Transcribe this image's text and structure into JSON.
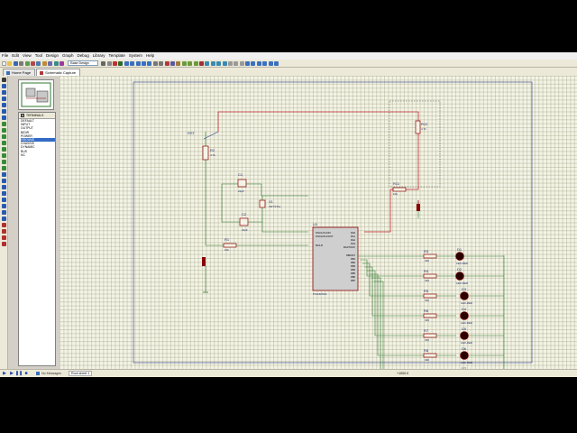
{
  "menu": [
    "File",
    "Edit",
    "View",
    "Tool",
    "Design",
    "Graph",
    "Debug",
    "Library",
    "Template",
    "System",
    "Help"
  ],
  "toolbar": {
    "design_dropdown": "Base Design"
  },
  "tabs": [
    {
      "label": "Home Page",
      "active": false
    },
    {
      "label": "Schematic Capture",
      "active": true
    }
  ],
  "device_panel": {
    "mode_letter": "P",
    "title": "TERMINALS",
    "items": [
      "DEFAULT",
      "INPUT",
      "OUTPUT",
      "BIDIR",
      "POWER",
      "GROUND",
      "CHASSIS",
      "DYNAMIC",
      "BUS",
      "NC"
    ],
    "selected": "GROUND"
  },
  "schematic": {
    "labels": {
      "rst": "RST",
      "c1": "C1",
      "c1_val": "22pF",
      "c2": "C2",
      "c2_val": "22pF",
      "x1": "X1",
      "x1_val": "CRYSTAL",
      "r2": "R2",
      "r2_val": "4.7k",
      "r1": "R1",
      "r1_val": "10k",
      "r11": "R11",
      "r11_val": "10k",
      "r12": "R12",
      "r12_val": "4.7k",
      "u1": "U1",
      "u1_part": "PIC16F84A",
      "u1_left_pins": [
        "OSC1/CLKIN",
        "OSC2/CLKOUT",
        "MCLR"
      ],
      "u1_right_pins": [
        "RA0",
        "RA1",
        "RA2",
        "RA3",
        "RA4/T0CKI",
        "RB0/INT",
        "RB1",
        "RB2",
        "RB3",
        "RB4",
        "RB5",
        "RB6",
        "RB7"
      ],
      "resistors": [
        {
          "ref": "R3",
          "val": "330"
        },
        {
          "ref": "R4",
          "val": "330"
        },
        {
          "ref": "R5",
          "val": "330"
        },
        {
          "ref": "R6",
          "val": "330"
        },
        {
          "ref": "R7",
          "val": "330"
        },
        {
          "ref": "R8",
          "val": "330"
        },
        {
          "ref": "R9",
          "val": "330"
        },
        {
          "ref": "R10",
          "val": "330"
        }
      ],
      "leds": [
        {
          "ref": "D1",
          "val": "LED-RED"
        },
        {
          "ref": "D2",
          "val": "LED-RED"
        },
        {
          "ref": "D3",
          "val": "LED-RED"
        },
        {
          "ref": "D4",
          "val": "LED-RED"
        },
        {
          "ref": "D5",
          "val": "LED-RED"
        },
        {
          "ref": "D6",
          "val": "LED-RED"
        },
        {
          "ref": "D7",
          "val": "LED-RED"
        },
        {
          "ref": "D8",
          "val": "LED-RED"
        }
      ]
    },
    "colors": {
      "wire": "#2d7a2d",
      "power_wire": "#c0262b",
      "component": "#8b0000",
      "led": "#2a0000"
    }
  },
  "status": {
    "messages": "No Messages",
    "sheet": "Root sheet 1",
    "coord": "+1000.0"
  }
}
